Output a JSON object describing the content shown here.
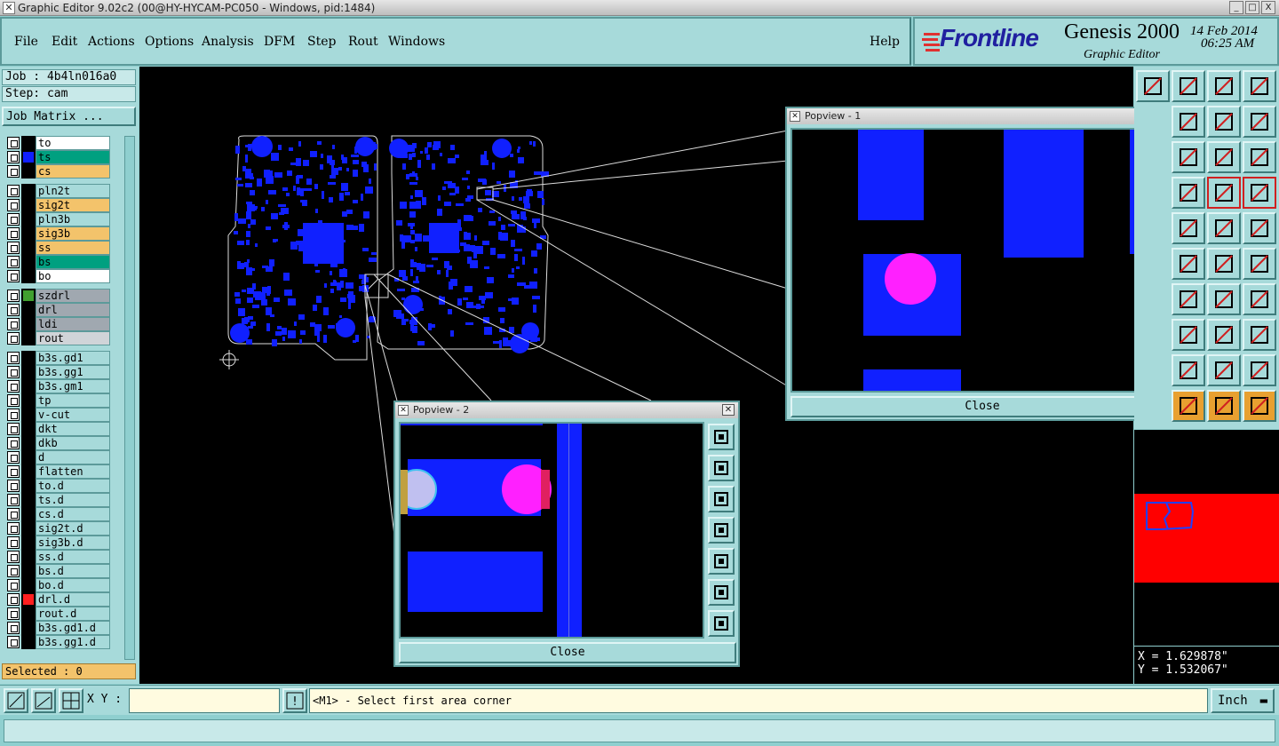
{
  "window": {
    "title": "Graphic Editor 9.02c2 (00@HY-HYCAM-PC050 - Windows, pid:1484)"
  },
  "menu": {
    "items": [
      "File",
      "Edit",
      "Actions",
      "Options",
      "Analysis",
      "DFM",
      "Step",
      "Rout",
      "Windows"
    ],
    "help": "Help"
  },
  "brand": {
    "logo": "Frontline",
    "product": "Genesis 2000",
    "subtitle": "Graphic Editor",
    "date": "14 Feb 2014",
    "time": "06:25 AM"
  },
  "job": {
    "job_label": "Job : 4b4ln016a0",
    "step_label": "Step: cam",
    "matrix_button": "Job Matrix ..."
  },
  "layers": [
    {
      "name": "to",
      "color": "#ffffff",
      "swatch": ""
    },
    {
      "name": "ts",
      "color": "#00a080",
      "swatch": "#1020ff"
    },
    {
      "name": "cs",
      "color": "#f3c36b",
      "swatch": ""
    },
    {
      "name": "pln2t",
      "color": "#a7dada",
      "swatch": ""
    },
    {
      "name": "sig2t",
      "color": "#f3c36b",
      "swatch": ""
    },
    {
      "name": "pln3b",
      "color": "#a7dada",
      "swatch": ""
    },
    {
      "name": "sig3b",
      "color": "#f3c36b",
      "swatch": ""
    },
    {
      "name": "ss",
      "color": "#f3c36b",
      "swatch": ""
    },
    {
      "name": "bs",
      "color": "#00a080",
      "swatch": ""
    },
    {
      "name": "bo",
      "color": "#ffffff",
      "swatch": ""
    },
    {
      "name": "szdrl",
      "color": "#a0a8b0",
      "swatch": "#40a030"
    },
    {
      "name": "drl",
      "color": "#a0a8b0",
      "swatch": ""
    },
    {
      "name": "ldi",
      "color": "#a0a8b0",
      "swatch": ""
    },
    {
      "name": "rout",
      "color": "#d0d4d8",
      "swatch": ""
    },
    {
      "name": "b3s.gd1",
      "color": "#a7dada",
      "swatch": ""
    },
    {
      "name": "b3s.gg1",
      "color": "#a7dada",
      "swatch": ""
    },
    {
      "name": "b3s.gm1",
      "color": "#a7dada",
      "swatch": ""
    },
    {
      "name": "tp",
      "color": "#a7dada",
      "swatch": ""
    },
    {
      "name": "v-cut",
      "color": "#a7dada",
      "swatch": ""
    },
    {
      "name": "dkt",
      "color": "#a7dada",
      "swatch": ""
    },
    {
      "name": "dkb",
      "color": "#a7dada",
      "swatch": ""
    },
    {
      "name": "d",
      "color": "#a7dada",
      "swatch": ""
    },
    {
      "name": "flatten",
      "color": "#a7dada",
      "swatch": ""
    },
    {
      "name": "to.d",
      "color": "#a7dada",
      "swatch": ""
    },
    {
      "name": "ts.d",
      "color": "#a7dada",
      "swatch": ""
    },
    {
      "name": "cs.d",
      "color": "#a7dada",
      "swatch": ""
    },
    {
      "name": "sig2t.d",
      "color": "#a7dada",
      "swatch": ""
    },
    {
      "name": "sig3b.d",
      "color": "#a7dada",
      "swatch": ""
    },
    {
      "name": "ss.d",
      "color": "#a7dada",
      "swatch": ""
    },
    {
      "name": "bs.d",
      "color": "#a7dada",
      "swatch": ""
    },
    {
      "name": "bo.d",
      "color": "#a7dada",
      "swatch": ""
    },
    {
      "name": "drl.d",
      "color": "#a7dada",
      "swatch": "#ff2020"
    },
    {
      "name": "rout.d",
      "color": "#a7dada",
      "swatch": ""
    },
    {
      "name": "b3s.gd1.d",
      "color": "#a7dada",
      "swatch": ""
    },
    {
      "name": "b3s.gg1.d",
      "color": "#a7dada",
      "swatch": ""
    }
  ],
  "selected": "Selected : 0",
  "popview1": {
    "title": "Popview - 1",
    "close": "Close"
  },
  "popview2": {
    "title": "Popview - 2",
    "close": "Close"
  },
  "coords": {
    "x": "X = 1.629878\"",
    "y": "Y = 1.532067\""
  },
  "bottom": {
    "xy_label": "X Y :",
    "xy_value": "",
    "prompt": "<M1> - Select first area corner",
    "units": "Inch"
  },
  "colors": {
    "pad_blue": "#1020ff",
    "magenta": "#ff20ff",
    "bg_teal": "#a7dada",
    "orange": "#f3c36b",
    "red": "#ff0000"
  }
}
